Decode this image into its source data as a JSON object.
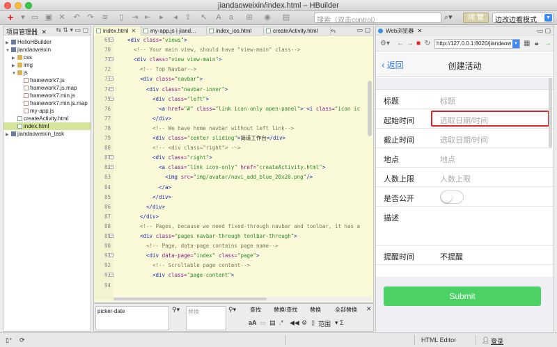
{
  "window": {
    "title": "jiandaoweixin/index.html – HBuilder"
  },
  "toolbar": {
    "search_placeholder": "搜索（双击control）",
    "preview_label": "闭 管",
    "mode_value": "边改边看模式"
  },
  "project_panel": {
    "title": "项目管理器",
    "items": [
      {
        "label": "HelloHBuilder",
        "type": "project",
        "indent": 0,
        "expanded": false
      },
      {
        "label": "jiandaoweixin",
        "type": "project",
        "indent": 0,
        "expanded": true
      },
      {
        "label": "css",
        "type": "folder",
        "indent": 1,
        "expanded": false
      },
      {
        "label": "img",
        "type": "folder",
        "indent": 1,
        "expanded": false
      },
      {
        "label": "js",
        "type": "folder",
        "indent": 1,
        "expanded": true
      },
      {
        "label": "framework7.js",
        "type": "file",
        "indent": 2
      },
      {
        "label": "framework7.js.map",
        "type": "file",
        "indent": 2
      },
      {
        "label": "framework7.min.js",
        "type": "file",
        "indent": 2
      },
      {
        "label": "framework7.min.js.map",
        "type": "file",
        "indent": 2
      },
      {
        "label": "my-app.js",
        "type": "file",
        "indent": 2
      },
      {
        "label": "createActivity.html",
        "type": "html",
        "indent": 1
      },
      {
        "label": "index.html",
        "type": "html",
        "indent": 1,
        "selected": true
      },
      {
        "label": "jiandaoweixin_task",
        "type": "project",
        "indent": 0,
        "expanded": false
      }
    ]
  },
  "editor": {
    "tabs": [
      {
        "label": "index.html",
        "active": true
      },
      {
        "label": "my-app.js | jiand…",
        "active": false
      },
      {
        "label": "index_ios.html",
        "active": false
      },
      {
        "label": "createActivity.html",
        "active": false
      }
    ],
    "more_tabs": "»₁",
    "lines": [
      {
        "n": "69",
        "fold": true,
        "indent": 4,
        "parts": [
          [
            "tag",
            "<div "
          ],
          [
            "attr",
            "class="
          ],
          [
            "str",
            "\"views\""
          ],
          [
            "tag",
            ">"
          ]
        ]
      },
      {
        "n": "70",
        "fold": false,
        "indent": 6,
        "parts": [
          [
            "cmt",
            "<!-- Your main view, should have \"view-main\" class-->"
          ]
        ]
      },
      {
        "n": "71",
        "fold": true,
        "indent": 6,
        "parts": [
          [
            "tag",
            "<div "
          ],
          [
            "attr",
            "class="
          ],
          [
            "str",
            "\"view view-main\""
          ],
          [
            "tag",
            ">"
          ]
        ]
      },
      {
        "n": "72",
        "fold": false,
        "indent": 8,
        "parts": [
          [
            "cmt",
            "<!-- Top Navbar-->"
          ]
        ]
      },
      {
        "n": "73",
        "fold": true,
        "indent": 8,
        "parts": [
          [
            "tag",
            "<div "
          ],
          [
            "attr",
            "class="
          ],
          [
            "str",
            "\"navbar\""
          ],
          [
            "tag",
            ">"
          ]
        ]
      },
      {
        "n": "74",
        "fold": true,
        "indent": 10,
        "parts": [
          [
            "tag",
            "<div "
          ],
          [
            "attr",
            "class="
          ],
          [
            "str",
            "\"navbar-inner\""
          ],
          [
            "tag",
            ">"
          ]
        ]
      },
      {
        "n": "75",
        "fold": true,
        "indent": 12,
        "parts": [
          [
            "tag",
            "<div "
          ],
          [
            "attr",
            "class="
          ],
          [
            "str",
            "\"left\""
          ],
          [
            "tag",
            ">"
          ]
        ]
      },
      {
        "n": "76",
        "fold": false,
        "indent": 14,
        "parts": [
          [
            "tag",
            "<a "
          ],
          [
            "attr",
            "href="
          ],
          [
            "str",
            "\"#\" "
          ],
          [
            "attr",
            "class="
          ],
          [
            "str",
            "\"link icon-only open-panel\""
          ],
          [
            "tag",
            "> <i "
          ],
          [
            "attr",
            "class="
          ],
          [
            "str",
            "\"icon ic"
          ]
        ]
      },
      {
        "n": "77",
        "fold": false,
        "indent": 12,
        "parts": [
          [
            "tag",
            "</div>"
          ]
        ]
      },
      {
        "n": "78",
        "fold": false,
        "indent": 12,
        "parts": [
          [
            "cmt",
            "<!-- We have home navbar without left link-->"
          ]
        ]
      },
      {
        "n": "79",
        "fold": false,
        "indent": 12,
        "parts": [
          [
            "tag",
            "<div "
          ],
          [
            "attr",
            "class="
          ],
          [
            "str",
            "\"center sliding\""
          ],
          [
            "tag",
            ">"
          ],
          [
            "txt",
            "简道工作台"
          ],
          [
            "tag",
            "</div>"
          ]
        ]
      },
      {
        "n": "80",
        "fold": false,
        "indent": 12,
        "parts": [
          [
            "cmt",
            "<!-- <div class=\"right\"> -->"
          ]
        ]
      },
      {
        "n": "81",
        "fold": true,
        "indent": 12,
        "parts": [
          [
            "tag",
            "<div "
          ],
          [
            "attr",
            "class="
          ],
          [
            "str",
            "\"right\""
          ],
          [
            "tag",
            ">"
          ]
        ]
      },
      {
        "n": "82",
        "fold": true,
        "indent": 14,
        "parts": [
          [
            "tag",
            "<a "
          ],
          [
            "attr",
            "class="
          ],
          [
            "str",
            "\"link icon-only\" "
          ],
          [
            "attr",
            "href="
          ],
          [
            "str",
            "\"createActivity.html\""
          ],
          [
            "tag",
            ">"
          ]
        ]
      },
      {
        "n": "83",
        "fold": false,
        "indent": 16,
        "parts": [
          [
            "tag",
            "<img "
          ],
          [
            "attr",
            "src="
          ],
          [
            "str",
            "\"img/avatar/navi_add_blue_20x20.png\""
          ],
          [
            "tag",
            "/>"
          ]
        ]
      },
      {
        "n": "84",
        "fold": false,
        "indent": 14,
        "parts": [
          [
            "tag",
            "</a>"
          ]
        ]
      },
      {
        "n": "85",
        "fold": false,
        "indent": 12,
        "parts": [
          [
            "tag",
            "</div>"
          ]
        ]
      },
      {
        "n": "86",
        "fold": false,
        "indent": 10,
        "parts": [
          [
            "tag",
            "</div>"
          ]
        ]
      },
      {
        "n": "87",
        "fold": false,
        "indent": 8,
        "parts": [
          [
            "tag",
            "</div>"
          ]
        ]
      },
      {
        "n": "88",
        "fold": false,
        "indent": 8,
        "parts": [
          [
            "cmt",
            "<!-- Pages, because we need fixed-through navbar and toolbar, it has a"
          ]
        ]
      },
      {
        "n": "89",
        "fold": true,
        "indent": 8,
        "parts": [
          [
            "tag",
            "<div "
          ],
          [
            "attr",
            "class="
          ],
          [
            "str",
            "\"pages navbar-through toolbar-through\""
          ],
          [
            "tag",
            ">"
          ]
        ]
      },
      {
        "n": "90",
        "fold": false,
        "indent": 10,
        "parts": [
          [
            "cmt",
            "<!-- Page, data-page contains page name-->"
          ]
        ]
      },
      {
        "n": "91",
        "fold": true,
        "indent": 10,
        "parts": [
          [
            "tag",
            "<div "
          ],
          [
            "attr",
            "data-page="
          ],
          [
            "str",
            "\"index\" "
          ],
          [
            "attr",
            "class="
          ],
          [
            "str",
            "\"page\""
          ],
          [
            "tag",
            ">"
          ]
        ]
      },
      {
        "n": "92",
        "fold": false,
        "indent": 12,
        "parts": [
          [
            "cmt",
            "<!-- Scrollable page content-->"
          ]
        ]
      },
      {
        "n": "93",
        "fold": true,
        "indent": 12,
        "parts": [
          [
            "tag",
            "<div "
          ],
          [
            "attr",
            "class="
          ],
          [
            "str",
            "\"page-content\""
          ],
          [
            "tag",
            ">"
          ]
        ]
      },
      {
        "n": "94",
        "fold": false,
        "indent": 0,
        "parts": []
      }
    ]
  },
  "find_panel": {
    "search_value": "picker-date",
    "replace_placeholder": "替换",
    "find_label": "查找",
    "replace_find_label": "替换/查找",
    "replace_label": "替换",
    "replace_all_label": "全部替换",
    "scope_label": "范围",
    "font_label": "aA"
  },
  "browser": {
    "title": "Web浏览器",
    "url": "http://127.0.0.1:8020/jiandaow",
    "app": {
      "back_label": "返回",
      "title": "创建活动",
      "fields": [
        {
          "label": "标题",
          "value": "标题",
          "kind": "input"
        },
        {
          "label": "起始时间",
          "value": "选取日期/时间",
          "kind": "input",
          "highlighted": true
        },
        {
          "label": "截止时间",
          "value": "选取日期/时间",
          "kind": "input"
        },
        {
          "label": "地点",
          "value": "地点",
          "kind": "input"
        },
        {
          "label": "人数上限",
          "value": "人数上限",
          "kind": "input"
        },
        {
          "label": "是否公开",
          "value": "",
          "kind": "toggle"
        },
        {
          "label": "描述",
          "value": "",
          "kind": "textarea"
        },
        {
          "label": "提醒时间",
          "value": "不提醒",
          "kind": "select"
        }
      ],
      "submit_label": "Submit",
      "colors": {
        "accent": "#2f7ce3",
        "submit": "#4cd264",
        "highlight": "#e52020"
      }
    }
  },
  "statusbar": {
    "editor_mode": "HTML Editor",
    "login_label": "登录"
  }
}
